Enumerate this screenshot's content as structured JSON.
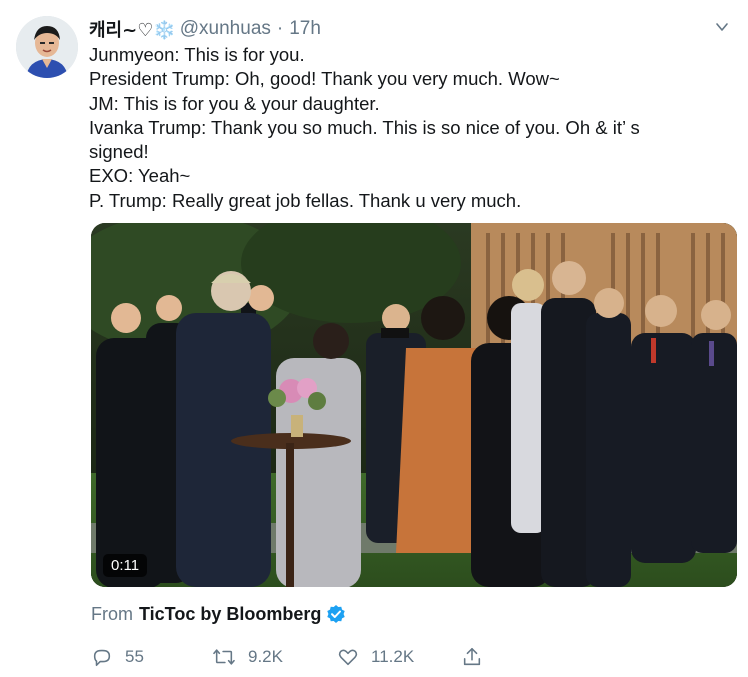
{
  "tweet": {
    "display_name": "캐리~♡❄️",
    "handle": "@xunhuas",
    "separator": "·",
    "time": "17h",
    "lines": [
      "Junmyeon: This is for you.",
      "President Trump: Oh, good! Thank you very much. Wow~",
      "JM: This is for you & your daughter.",
      "Ivanka Trump: Thank you so much. This is so nice of you. Oh & it’ s",
      "signed!",
      "EXO: Yeah~",
      "P. Trump: Really great job fellas. Thank u very much."
    ],
    "media": {
      "duration": "0:11"
    },
    "source": {
      "prefix": "From",
      "name": "TicToc by Bloomberg"
    },
    "actions": {
      "replies": "55",
      "retweets": "9.2K",
      "likes": "11.2K"
    }
  },
  "icons": {
    "reply": "reply-icon",
    "retweet": "retweet-icon",
    "like": "heart-icon",
    "share": "share-icon",
    "verified": "verified-badge-icon",
    "menu": "chevron-down-icon"
  },
  "colors": {
    "text_primary": "#14171a",
    "text_secondary": "#657786",
    "verified_blue": "#1da1f2"
  }
}
